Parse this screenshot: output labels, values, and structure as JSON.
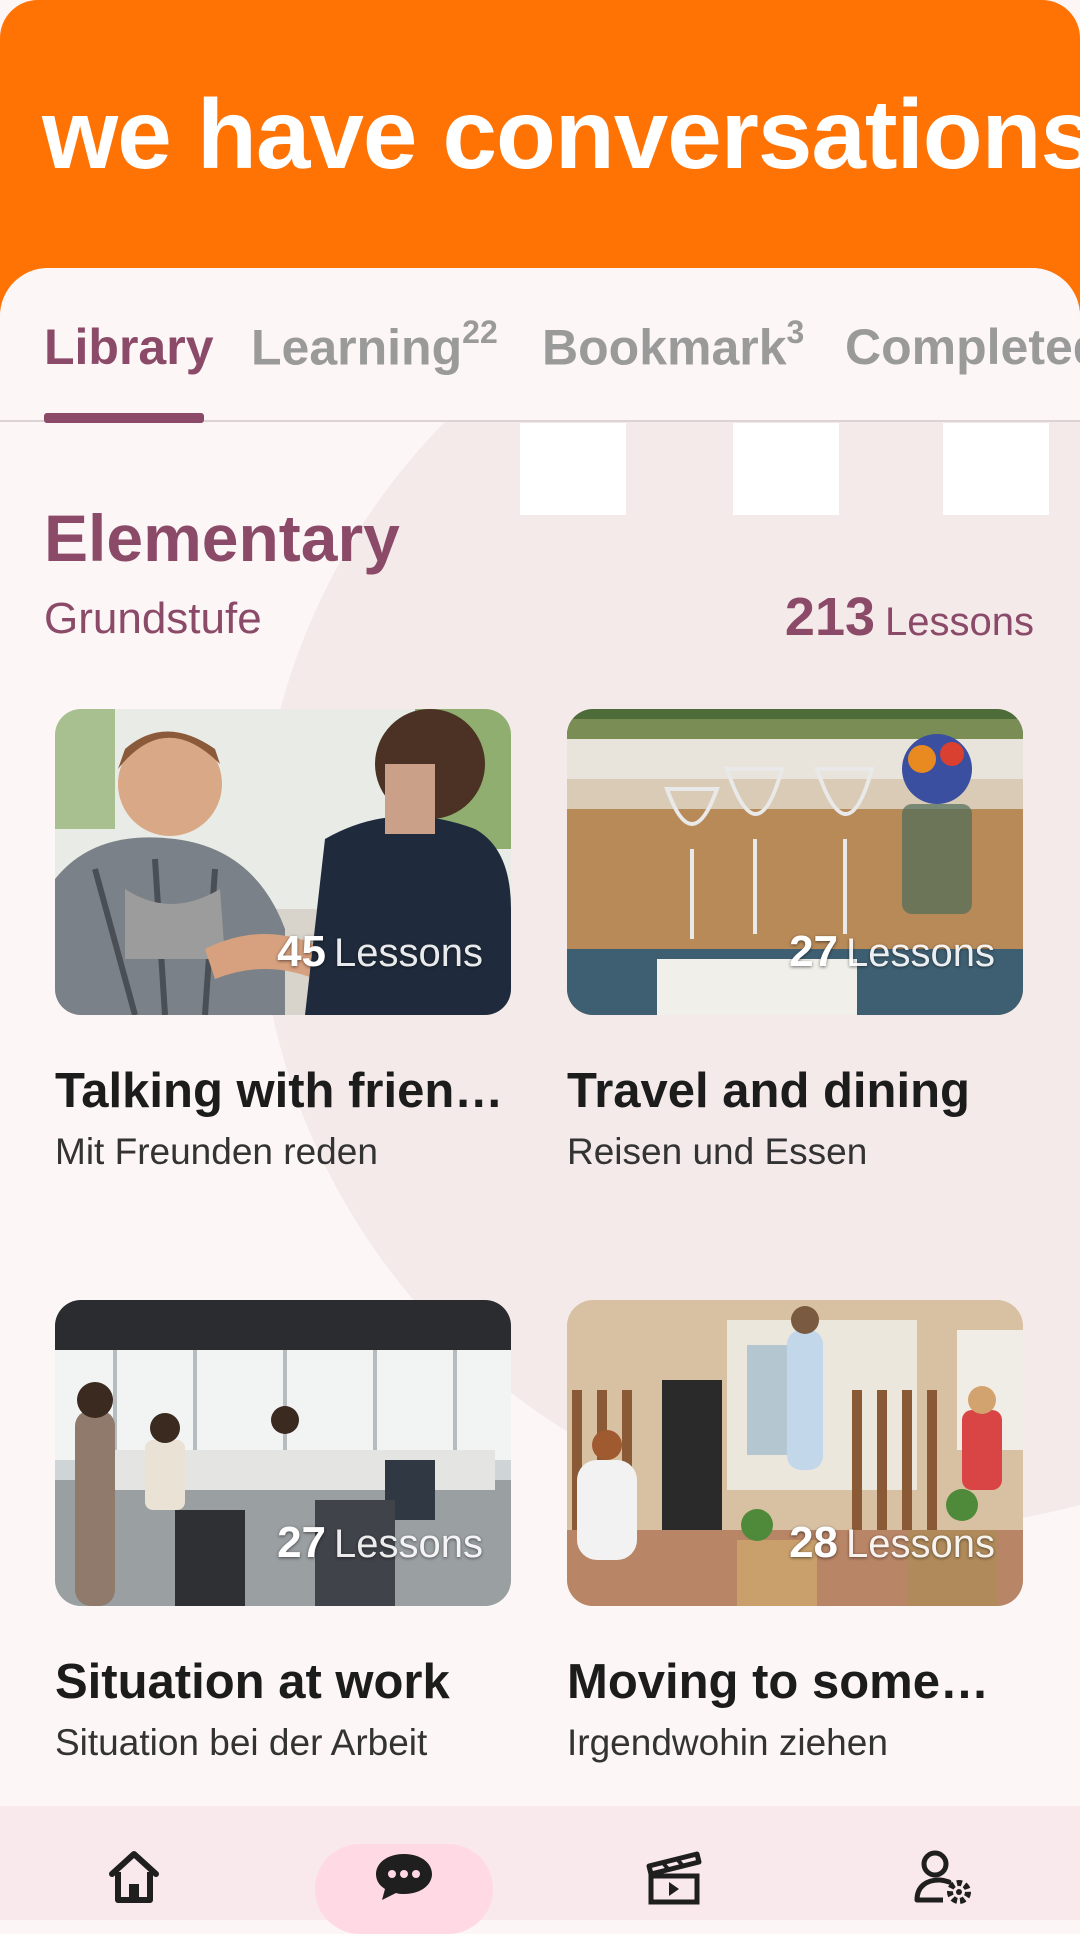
{
  "header": {
    "title": "we have conversations"
  },
  "tabs": [
    {
      "label": "Library",
      "badge": ""
    },
    {
      "label": "Learning",
      "badge": "22"
    },
    {
      "label": "Bookmark",
      "badge": "3"
    },
    {
      "label": "Completed",
      "badge": ""
    }
  ],
  "level": {
    "title": "Elementary",
    "subtitle": "Grundstufe",
    "lesson_count": "213",
    "lessons_label": "Lessons"
  },
  "cards": [
    {
      "count": "45",
      "lessons_label": "Lessons",
      "title": "Talking with frien…",
      "subtitle": "Mit Freunden reden"
    },
    {
      "count": "27",
      "lessons_label": "Lessons",
      "title": "Travel and dining",
      "subtitle": "Reisen und Essen"
    },
    {
      "count": "27",
      "lessons_label": "Lessons",
      "title": "Situation at work",
      "subtitle": "Situation bei der Arbeit"
    },
    {
      "count": "28",
      "lessons_label": "Lessons",
      "title": "Moving to somew…",
      "subtitle": "Irgendwohin ziehen"
    }
  ],
  "bottom_nav": [
    {
      "icon": "home-icon",
      "active": false
    },
    {
      "icon": "chat-icon",
      "active": true
    },
    {
      "icon": "clapperboard-icon",
      "active": false
    },
    {
      "icon": "user-settings-icon",
      "active": false
    }
  ],
  "colors": {
    "header_bg": "#ff7204",
    "accent": "#8a4a68",
    "nav_bg": "#f9e8ec",
    "nav_active_pill": "#ffd9e3"
  }
}
